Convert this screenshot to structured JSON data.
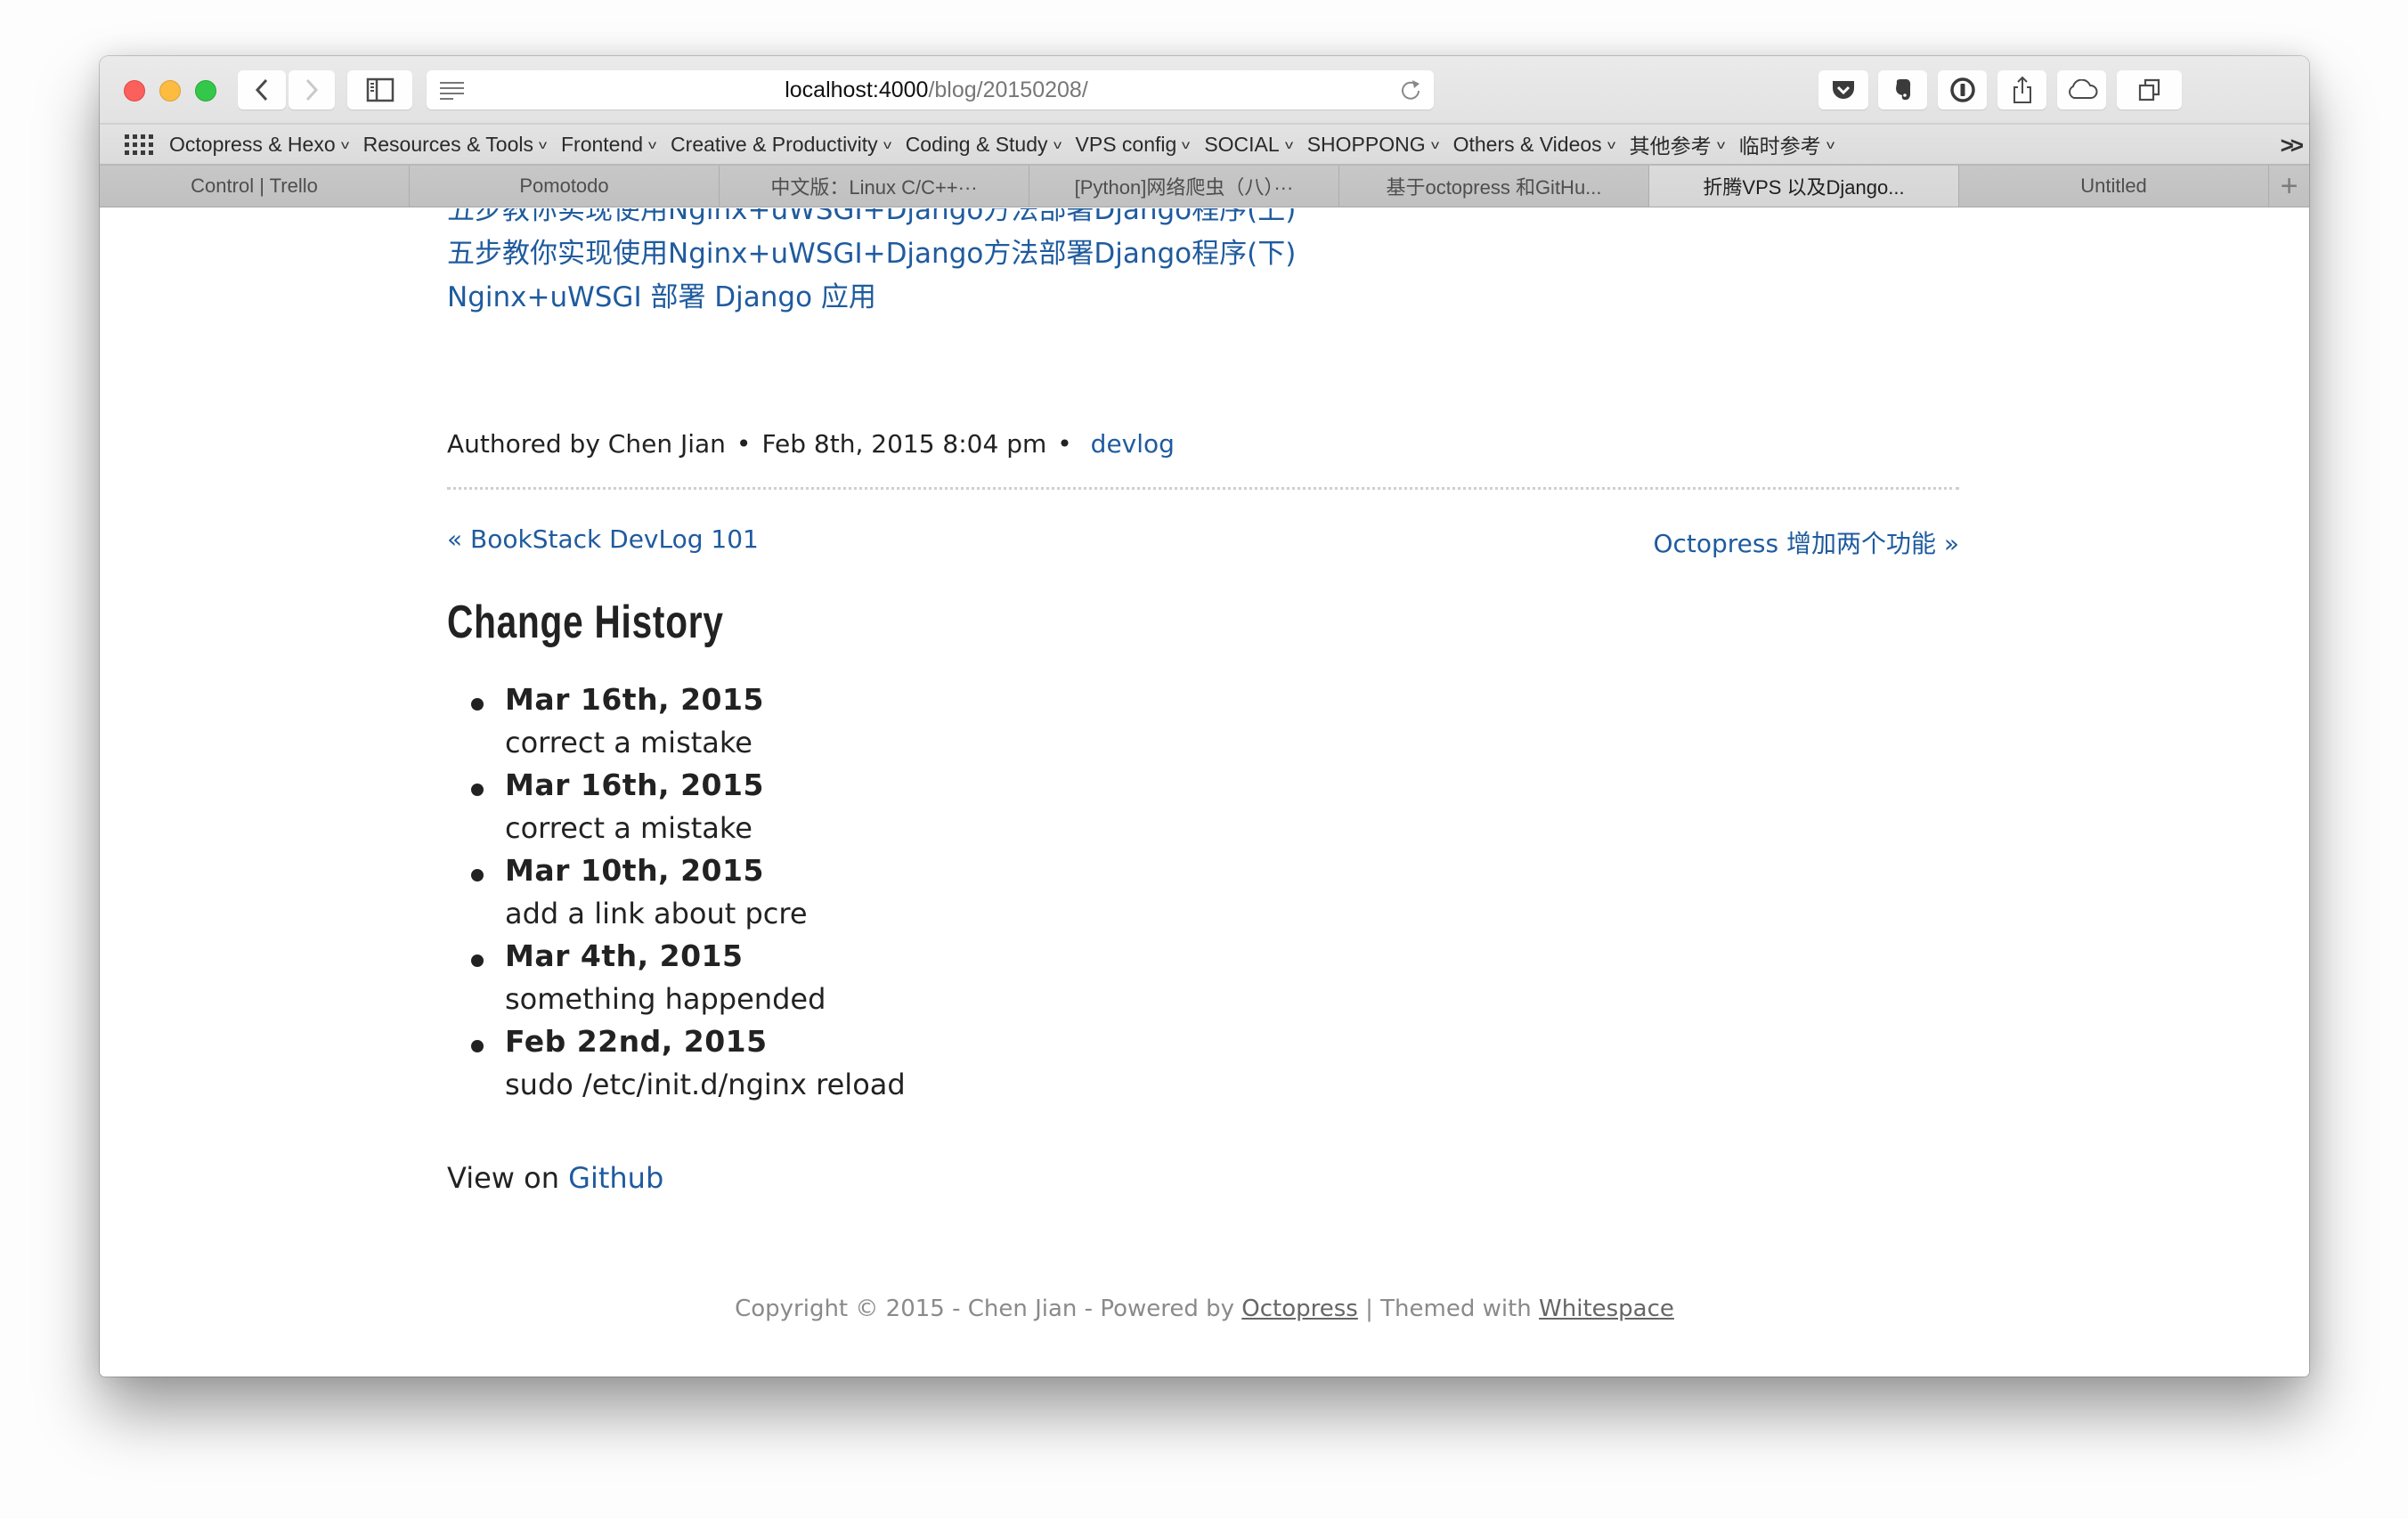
{
  "browser": {
    "url_host": "localhost:4000",
    "url_path": "/blog/20150208/",
    "extensions": [
      {
        "name": "pocket-icon"
      },
      {
        "name": "evernote-icon"
      },
      {
        "name": "1password-icon"
      },
      {
        "name": "share-icon"
      },
      {
        "name": "icloud-tabs-icon"
      },
      {
        "name": "tab-overview-icon"
      }
    ],
    "bookmarks": [
      {
        "label": "Octopress & Hexo"
      },
      {
        "label": "Resources & Tools"
      },
      {
        "label": "Frontend"
      },
      {
        "label": "Creative & Productivity"
      },
      {
        "label": "Coding & Study"
      },
      {
        "label": "VPS config"
      },
      {
        "label": "SOCIAL"
      },
      {
        "label": "SHOPPONG"
      },
      {
        "label": "Others & Videos"
      },
      {
        "label": "其他参考"
      },
      {
        "label": "临时参考"
      }
    ],
    "bookmarks_overflow": ">>",
    "tabs": [
      {
        "label": "Control | Trello",
        "active": false
      },
      {
        "label": "Pomotodo",
        "active": false
      },
      {
        "label": "中文版：Linux C/C++···",
        "active": false
      },
      {
        "label": "[Python]网络爬虫（八）···",
        "active": false
      },
      {
        "label": "基于octopress 和GitHu...",
        "active": false
      },
      {
        "label": "折腾VPS 以及Django...",
        "active": true
      },
      {
        "label": "Untitled",
        "active": false
      }
    ],
    "new_tab_label": "+"
  },
  "page": {
    "related_links": [
      "五步教你实现使用Nginx+uWSGI+Django方法部署Django程序(上)",
      "五步教你实现使用Nginx+uWSGI+Django方法部署Django程序(下)",
      "Nginx+uWSGI 部署 Django 应用"
    ],
    "meta": {
      "author": "Authored by Chen Jian",
      "date": "Feb 8th, 2015 8:04 pm",
      "bullet": "•",
      "category": "devlog"
    },
    "pager": {
      "prev": "« BookStack DevLog 101",
      "next": "Octopress 增加两个功能 »"
    },
    "history_title": "Change History",
    "history": [
      {
        "date": "Mar 16th, 2015",
        "note": "correct a mistake"
      },
      {
        "date": "Mar 16th, 2015",
        "note": "correct a mistake"
      },
      {
        "date": "Mar 10th, 2015",
        "note": "add a link about pcre"
      },
      {
        "date": "Mar 4th, 2015",
        "note": "something happended"
      },
      {
        "date": "Feb 22nd, 2015",
        "note": "sudo /etc/init.d/nginx reload"
      }
    ],
    "view_on": "View on ",
    "github_link": "Github",
    "footer": {
      "copyright": "Copyright © 2015 - Chen Jian - Powered by ",
      "octopress": "Octopress",
      "themed": " | Themed with ",
      "whitespace": "Whitespace"
    }
  },
  "colors": {
    "link": "#1f5b9e",
    "text": "#222222",
    "footer": "#8a8a8a"
  }
}
